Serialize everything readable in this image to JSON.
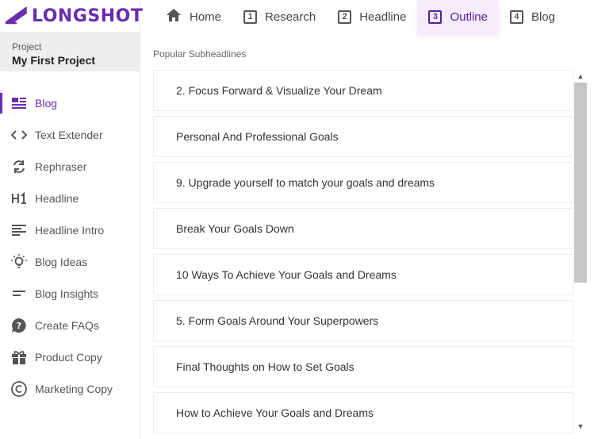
{
  "brand": {
    "name": "LONGSHOT",
    "color": "#6a2cb0"
  },
  "project": {
    "label": "Project",
    "name": "My First Project"
  },
  "sidebar": {
    "items": [
      {
        "label": "Blog",
        "icon": "blog-icon",
        "active": true
      },
      {
        "label": "Text Extender",
        "icon": "code-icon"
      },
      {
        "label": "Rephraser",
        "icon": "refresh-icon"
      },
      {
        "label": "Headline",
        "icon": "h1-icon"
      },
      {
        "label": "Headline Intro",
        "icon": "headline-intro-icon"
      },
      {
        "label": "Blog Ideas",
        "icon": "lightbulb-icon"
      },
      {
        "label": "Blog Insights",
        "icon": "insights-icon"
      },
      {
        "label": "Create FAQs",
        "icon": "faq-icon"
      },
      {
        "label": "Product Copy",
        "icon": "gift-icon"
      },
      {
        "label": "Marketing Copy",
        "icon": "copyright-icon"
      }
    ]
  },
  "tabs": [
    {
      "label": "Home",
      "icon": "home-icon"
    },
    {
      "label": "Research",
      "num": "1"
    },
    {
      "label": "Headline",
      "num": "2"
    },
    {
      "label": "Outline",
      "num": "3",
      "active": true
    },
    {
      "label": "Blog",
      "num": "4"
    }
  ],
  "main": {
    "section_title": "Popular Subheadlines",
    "subheadlines": [
      "2. Focus Forward & Visualize Your Dream",
      "Personal And Professional Goals",
      "9. Upgrade yourself to match your goals and dreams",
      "Break Your Goals Down",
      "10 Ways To Achieve Your Goals and Dreams",
      "5. Form Goals Around Your Superpowers",
      "Final Thoughts on How to Set Goals",
      "How to Achieve Your Goals and Dreams"
    ]
  }
}
